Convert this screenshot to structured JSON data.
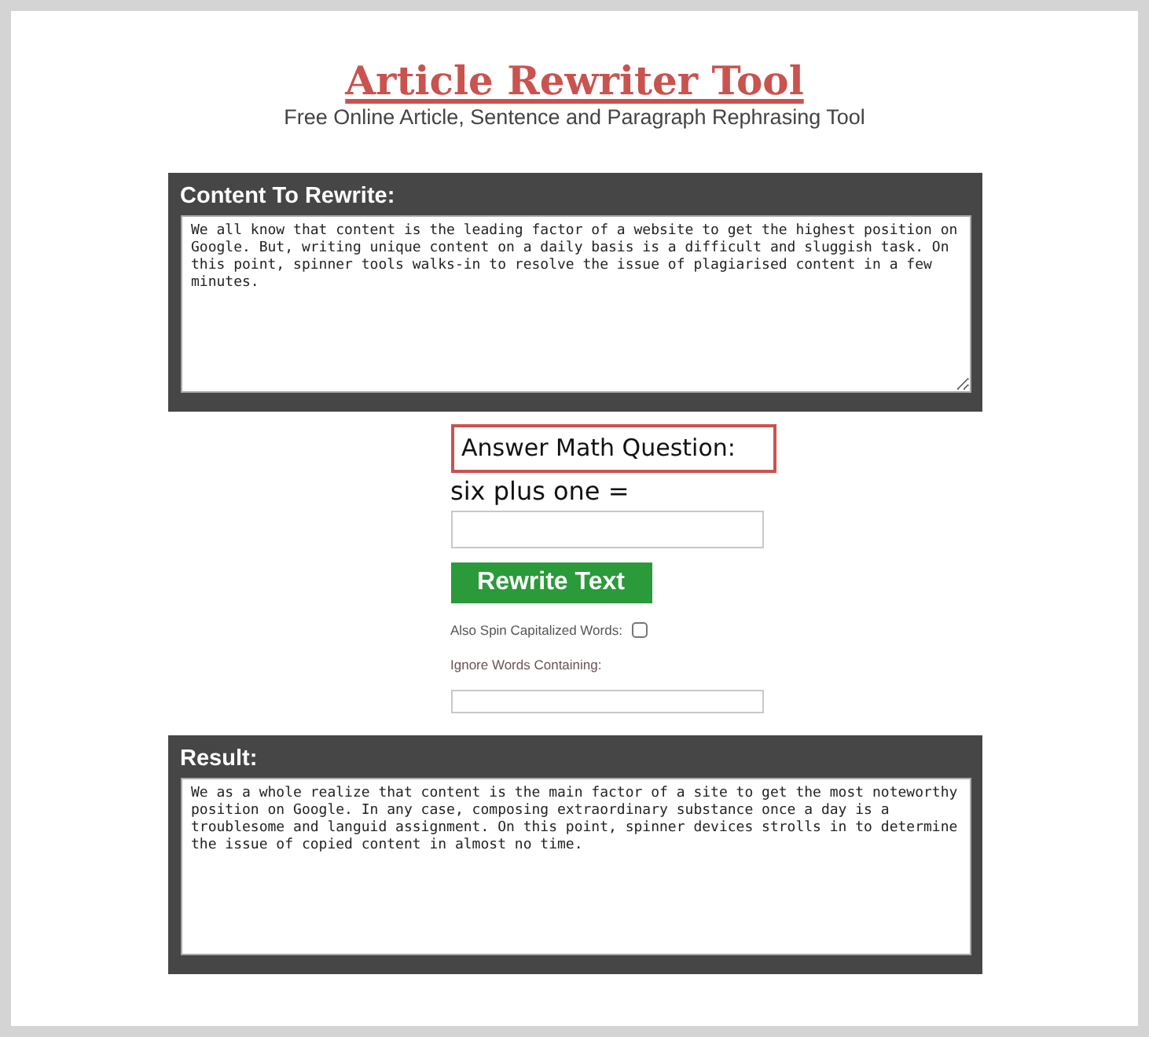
{
  "page": {
    "title": "Article Rewriter Tool",
    "subtitle": "Free Online Article, Sentence and Paragraph Rephrasing Tool"
  },
  "content_panel": {
    "heading": "Content To Rewrite:",
    "text": "We all know that content is the leading factor of a website to get the highest position on Google. But, writing unique content on a daily basis is a difficult and sluggish task. On this point, spinner tools walks-in to resolve the issue of plagiarised content in a few minutes."
  },
  "math_question": {
    "heading": "Answer Math Question:",
    "question": "six plus one ="
  },
  "rewrite_button": {
    "label": "Rewrite Text"
  },
  "options": [
    {
      "kind": "checkbox",
      "label": "Also Spin Capitalized Words:",
      "checked": false
    },
    {
      "kind": "text",
      "label": "Ignore Words Containing:"
    }
  ],
  "result_panel": {
    "heading": "Result:",
    "text": "We as a whole realize that content is the main factor of a site to get the most noteworthy position on Google. In any case, composing extraordinary substance once a day is a troublesome and languid assignment. On this point, spinner devices strolls in to determine the issue of copied content in almost no time."
  }
}
